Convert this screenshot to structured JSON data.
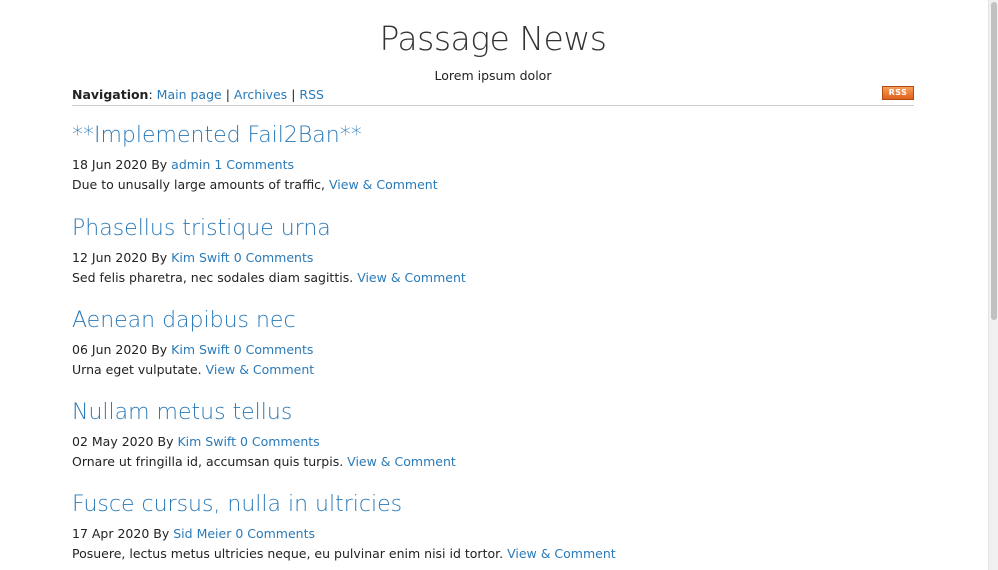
{
  "site": {
    "title": "Passage News",
    "subtitle": "Lorem ipsum dolor"
  },
  "nav": {
    "label": "Navigation",
    "colon": ":",
    "separator": "|",
    "items": [
      {
        "label": "Main page"
      },
      {
        "label": "Archives"
      },
      {
        "label": "RSS"
      }
    ],
    "rss_badge": "RSS"
  },
  "posts": [
    {
      "title": "**Implemented Fail2Ban**",
      "date": "18 Jun 2020",
      "by": "By",
      "author": "admin",
      "comments": "1 Comments",
      "excerpt": "Due to unusally large amounts of traffic,",
      "link": "View & Comment"
    },
    {
      "title": "Phasellus tristique urna",
      "date": "12 Jun 2020",
      "by": "By",
      "author": "Kim Swift",
      "comments": "0 Comments",
      "excerpt": "Sed felis pharetra, nec sodales diam sagittis.",
      "link": "View & Comment"
    },
    {
      "title": "Aenean dapibus nec",
      "date": "06 Jun 2020",
      "by": "By",
      "author": "Kim Swift",
      "comments": "0 Comments",
      "excerpt": "Urna eget vulputate.",
      "link": "View & Comment"
    },
    {
      "title": "Nullam metus tellus",
      "date": "02 May 2020",
      "by": "By",
      "author": "Kim Swift",
      "comments": "0 Comments",
      "excerpt": "Ornare ut fringilla id, accumsan quis turpis.",
      "link": "View & Comment"
    },
    {
      "title": "Fusce cursus, nulla in ultricies",
      "date": "17 Apr 2020",
      "by": "By",
      "author": "Sid Meier",
      "comments": "0 Comments",
      "excerpt": "Posuere, lectus metus ultricies neque, eu pulvinar enim nisi id tortor.",
      "link": "View & Comment"
    }
  ],
  "colors": {
    "link": "#2a7ab8",
    "text": "#222222",
    "rss_orange": "#e0601a"
  }
}
